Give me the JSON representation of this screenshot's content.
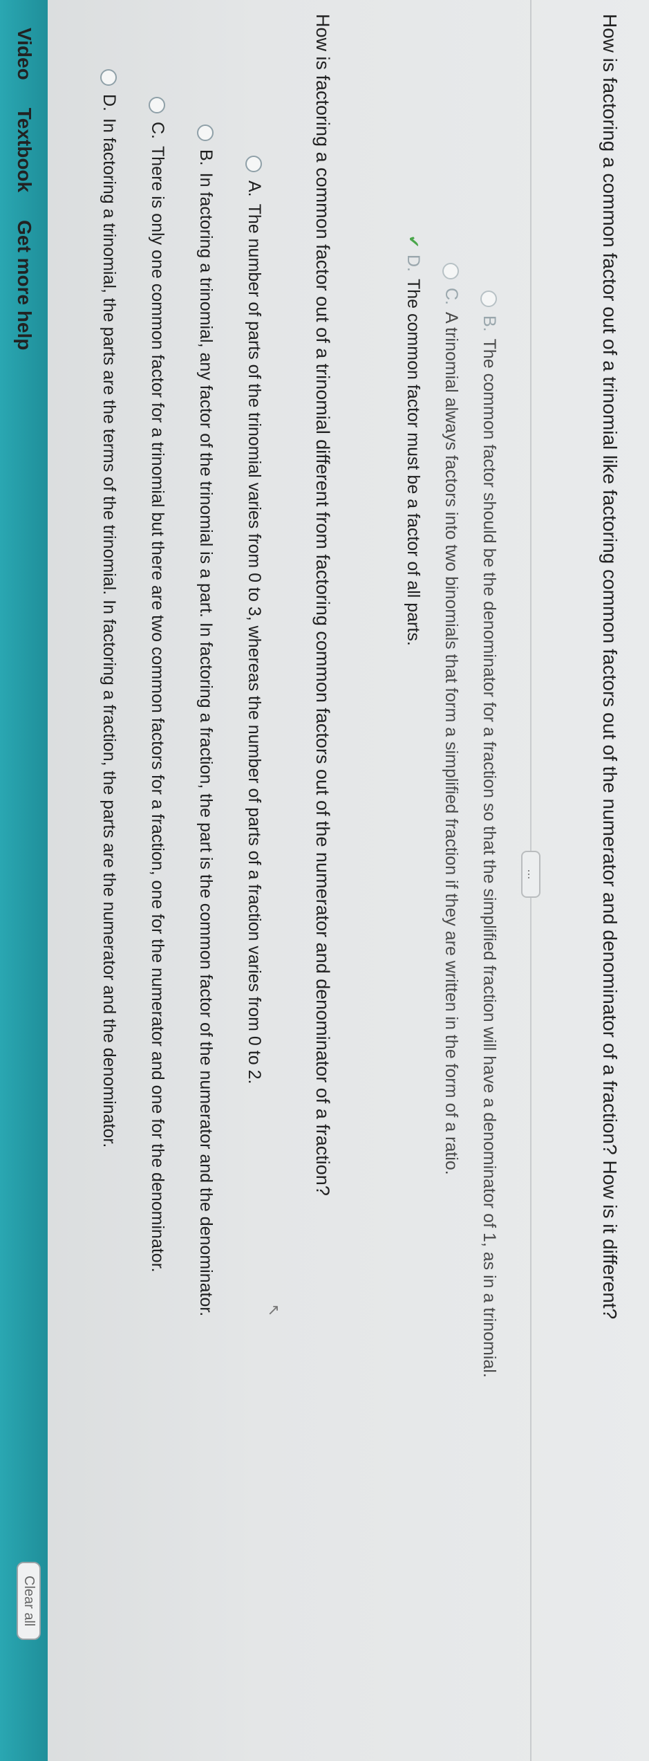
{
  "top_question": "How is factoring a common factor out of a trinomial like factoring common factors out of the numerator and denominator of a fraction? How is it different?",
  "ellipsis": "...",
  "first_group": [
    {
      "letter": "B.",
      "text": "The common factor should be the denominator for a fraction so that the simplified fraction will have a denominator of 1, as in a trinomial."
    },
    {
      "letter": "C.",
      "text": "A trinomial always factors into two binomials that form a simplified fraction if they are written in the form of a ratio."
    },
    {
      "letter": "D.",
      "text": "The common factor must be a factor of all parts."
    }
  ],
  "check_mark": "✔",
  "second_question": "How is factoring a common factor out of a trinomial different from factoring common factors out of the numerator and denominator of a fraction?",
  "second_group": [
    {
      "letter": "A.",
      "text": "The number of parts of the trinomial varies from 0 to 3, whereas the number of parts of a fraction varies from 0 to 2."
    },
    {
      "letter": "B.",
      "text": "In factoring a trinomial, any factor of the trinomial is a part. In factoring a fraction, the part is the common factor of the numerator and the denominator."
    },
    {
      "letter": "C.",
      "text": "There is only one common factor for a trinomial but there are two common factors for a fraction, one for the numerator and one for the denominator."
    },
    {
      "letter": "D.",
      "text": "In factoring a trinomial, the parts are the terms of the trinomial. In factoring a fraction, the parts are the numerator and the denominator."
    }
  ],
  "bottom_nav": [
    "Video",
    "Textbook",
    "Get more help"
  ],
  "clear_all": "Clear all",
  "colors": {
    "accent_teal": "#2aa7b2",
    "check_green": "#4aa64a"
  }
}
